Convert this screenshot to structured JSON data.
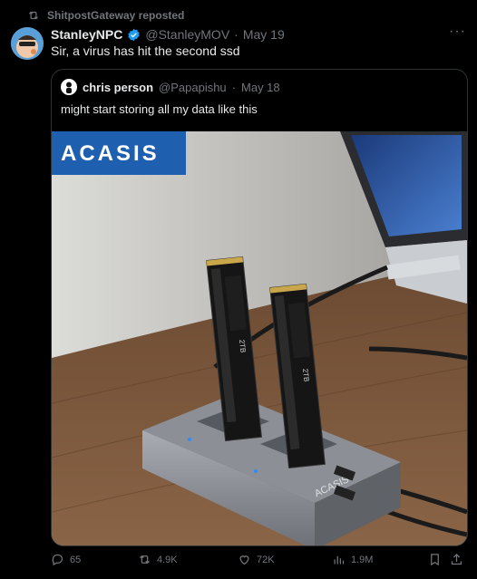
{
  "repost": {
    "label": "ShitpostGateway reposted",
    "icon": "repost-icon"
  },
  "post": {
    "display_name": "StanleyNPC",
    "handle": "@StanleyMOV",
    "date": "May 19",
    "separator": "·",
    "text": "Sir, a virus has hit the second ssd",
    "verified_color": "#1d9bf0"
  },
  "quote": {
    "display_name": "chris person",
    "handle": "@Papapishu",
    "date": "May 18",
    "separator": "·",
    "text": "might start storing all my data like this",
    "image": {
      "brand": "ACASIS",
      "drive_label": "2TB",
      "dock_brand": "ACASIS"
    }
  },
  "actions": {
    "replies": "65",
    "reposts": "4.9K",
    "likes": "72K",
    "views": "1.9M"
  },
  "colors": {
    "background": "#000000",
    "text": "#e7e9ea",
    "muted": "#71767b",
    "border": "#2f3336",
    "accent": "#1d9bf0"
  }
}
